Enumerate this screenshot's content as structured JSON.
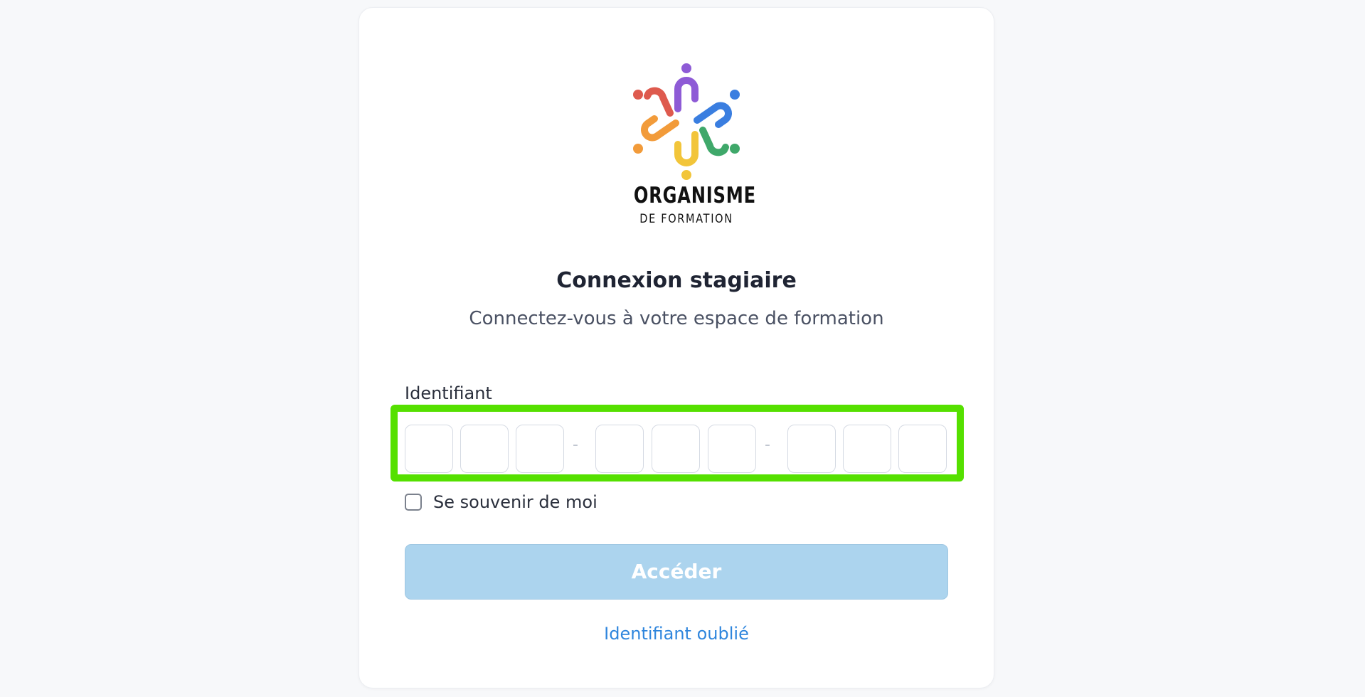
{
  "logo": {
    "title": "ORGANISME",
    "subtitle": "DE FORMATION",
    "colors": [
      "#8e5bd6",
      "#3a7ee0",
      "#3fa86a",
      "#f2c53a",
      "#f29b3a",
      "#de5a4e"
    ]
  },
  "login": {
    "title": "Connexion stagiaire",
    "subtitle": "Connectez-vous à votre espace de formation",
    "identifier_label": "Identifiant",
    "identifier_separator": "-",
    "identifier_boxes": [
      "",
      "",
      "",
      "",
      "",
      "",
      "",
      "",
      ""
    ],
    "remember_label": "Se souvenir de moi",
    "submit_label": "Accéder",
    "forgot_link": "Identifiant oublié"
  },
  "theme": {
    "highlight": "#55e000",
    "button_disabled": "#acd4ee",
    "link": "#2f86dd"
  }
}
